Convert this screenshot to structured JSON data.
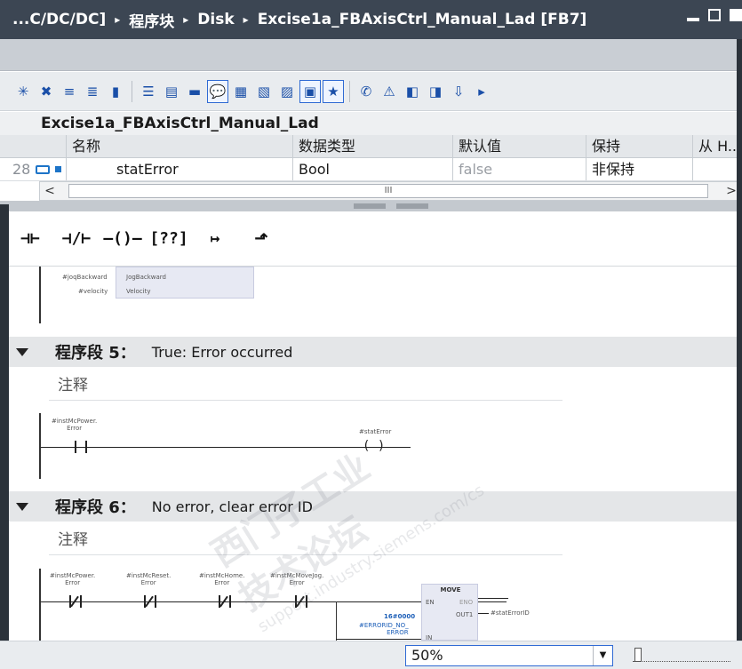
{
  "titlebar": {
    "crumbs": [
      "...C/DC/DC]",
      "程序块",
      "Disk",
      "Excise1a_FBAxisCtrl_Manual_Lad [FB7]"
    ],
    "separator": "▸"
  },
  "block": {
    "name": "Excise1a_FBAxisCtrl_Manual_Lad"
  },
  "interface": {
    "headers": [
      "名称",
      "数据类型",
      "默认值",
      "保持",
      "从 H..."
    ],
    "row": {
      "index": "28",
      "name": "statError",
      "type": "Bool",
      "default": "false",
      "retain": "非保持"
    }
  },
  "scrollbar": {
    "thumb_grip": "III",
    "left_arrow": "<",
    "right_arrow": ">"
  },
  "lad_toolbar": {
    "items": [
      {
        "name": "no-contact",
        "glyph": "⊣⊢"
      },
      {
        "name": "nc-contact",
        "glyph": "⊣/⊢"
      },
      {
        "name": "coil",
        "glyph": "–()–"
      },
      {
        "name": "empty-box",
        "glyph": "[??]"
      },
      {
        "name": "open-branch",
        "glyph": "↦"
      },
      {
        "name": "close-branch",
        "glyph": "⬏"
      }
    ]
  },
  "editor": {
    "prev_fragment": {
      "labels": [
        "#joqBackward",
        "#velocity"
      ],
      "pins": [
        "JogBackward",
        "Velocity"
      ]
    },
    "segment5": {
      "title": "程序段 5：",
      "description": "True: Error occurred",
      "comment": "注释",
      "contact_label": "#instMcPower.\nError",
      "coil_label": "#statError"
    },
    "segment6": {
      "title": "程序段 6：",
      "description": "No error, clear error ID",
      "comment": "注释",
      "contacts": [
        "#instMcPower.\nError",
        "#instMcReset.\nError",
        "#instMcHome.\nError",
        "#instMcMoveJog.\nError"
      ],
      "move": {
        "title": "MOVE",
        "en": "EN",
        "eno": "ENO",
        "out": "OUT1",
        "in": "IN",
        "in_value": "16#0000",
        "in_label": "#ERRORID_NO_\nERROR",
        "out_label": "#statErrorID"
      }
    }
  },
  "watermark": {
    "line1": "西门子工业",
    "line2": "技术论坛",
    "line3": "support.industry.siemens.com/cs"
  },
  "statusbar": {
    "zoom": "50%"
  }
}
